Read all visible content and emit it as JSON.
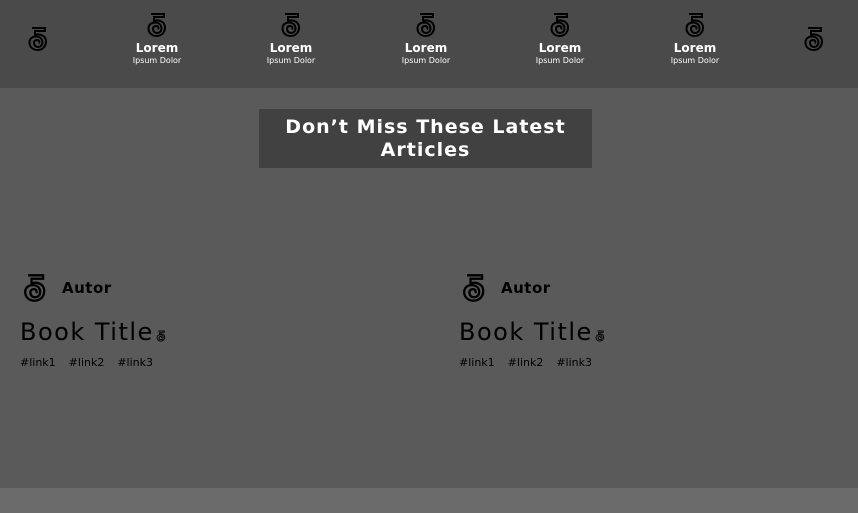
{
  "nav": {
    "items": [
      {
        "title": "Lorem",
        "subtitle": "Ipsum Dolor"
      },
      {
        "title": "Lorem",
        "subtitle": "Ipsum Dolor"
      },
      {
        "title": "Lorem",
        "subtitle": "Ipsum Dolor"
      },
      {
        "title": "Lorem",
        "subtitle": "Ipsum Dolor"
      },
      {
        "title": "Lorem",
        "subtitle": "Ipsum Dolor"
      }
    ],
    "logo_icon": "five-logo-icon"
  },
  "section": {
    "heading": "Don’t Miss These Latest Articles"
  },
  "articles": [
    {
      "author": "Autor",
      "title": "Book Title",
      "tags": [
        "#link1",
        "#link2",
        "#link3"
      ]
    },
    {
      "author": "Autor",
      "title": "Book Title",
      "tags": [
        "#link1",
        "#link2",
        "#link3"
      ]
    }
  ],
  "colors": {
    "background": "#5a5a5a",
    "topbar": "#4a4a4a",
    "heading_box": "#414141",
    "footer": "#6b6b6b",
    "text_light": "#ffffff",
    "text_dark": "#000000"
  }
}
